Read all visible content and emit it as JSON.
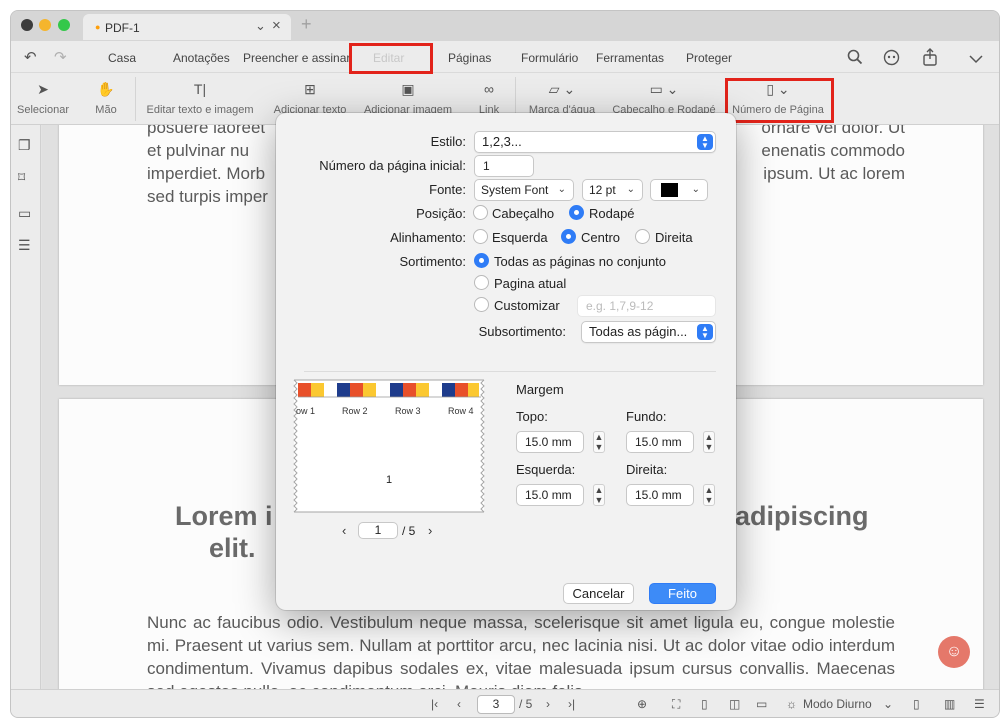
{
  "window": {
    "tab_title": "PDF-1",
    "tab_dot": "●",
    "tab_chevron": "⌄",
    "tab_close": "×",
    "new_tab": "+"
  },
  "menu": {
    "undo": "↶",
    "redo": "↷",
    "items": [
      "Casa",
      "Anotações",
      "Preencher e assinar",
      "Editar",
      "Páginas",
      "Formulário",
      "Ferramentas",
      "Proteger"
    ],
    "active": "Editar"
  },
  "toolbar": {
    "tools": [
      {
        "label": "Selecionar",
        "icon": "cursor-icon"
      },
      {
        "label": "Mão",
        "icon": "hand-icon"
      },
      {
        "label": "Editar texto e imagem",
        "icon": "text-edit-icon"
      },
      {
        "label": "Adicionar texto",
        "icon": "add-text-icon"
      },
      {
        "label": "Adicionar imagem",
        "icon": "add-image-icon"
      },
      {
        "label": "Link",
        "icon": "link-icon"
      },
      {
        "label": "Marca d'água",
        "icon": "watermark-icon"
      },
      {
        "label": "Cabeçalho e Rodapé",
        "icon": "header-footer-icon"
      },
      {
        "label": "Número de Página",
        "icon": "page-number-icon"
      }
    ]
  },
  "document": {
    "para1_lines": [
      "posuere laoreet",
      "et pulvinar nu",
      "imperdiet. Morb",
      "sed turpis imper"
    ],
    "para1_right": [
      "ornare vel dolor. Ut",
      "enenatis commodo",
      "ipsum. Ut ac lorem",
      ""
    ],
    "heading_left": "Lorem i",
    "heading_left2": "elit.",
    "heading_right": "adipiscing",
    "para2": "Nunc ac faucibus odio. Vestibulum neque massa, scelerisque sit amet ligula eu, congue molestie mi. Praesent ut varius sem. Nullam at porttitor arcu, nec lacinia nisi. Ut ac dolor vitae odio interdum condimentum. Vivamus dapibus sodales ex, vitae malesuada ipsum cursus convallis. Maecenas sed egestas nulla, ac condimentum orci. Mauris diam felis,"
  },
  "status": {
    "current_page": "3",
    "total": "/ 5",
    "mode": "Modo Diurno"
  },
  "dialog": {
    "estilo_label": "Estilo:",
    "estilo_value": "1,2,3...",
    "start_label": "Número da página inicial:",
    "start_value": "1",
    "fonte_label": "Fonte:",
    "font_value": "System Font",
    "size_value": "12 pt",
    "color_value": "#000000",
    "posicao_label": "Posição:",
    "pos_options": [
      "Cabeçalho",
      "Rodapé"
    ],
    "pos_selected": "Rodapé",
    "alinhamento_label": "Alinhamento:",
    "align_options": [
      "Esquerda",
      "Centro",
      "Direita"
    ],
    "align_selected": "Centro",
    "sortimento_label": "Sortimento:",
    "sort_options": [
      "Todas as páginas no conjunto",
      "Pagina atual",
      "Customizar"
    ],
    "sort_selected": "Todas as páginas no conjunto",
    "custom_placeholder": "e.g. 1,7,9-12",
    "subsort_label": "Subsortimento:",
    "subsort_value": "Todas as págin...",
    "preview": {
      "columns": [
        "ow 1",
        "Row 2",
        "Row 3",
        "Row 4"
      ],
      "page_number": "1",
      "nav_page": "1",
      "nav_total": "/ 5",
      "colors": [
        "#e8502a",
        "#fbc831",
        "#1e3c8c",
        "#ffffff"
      ]
    },
    "margem_title": "Margem",
    "margins": [
      {
        "label": "Topo:",
        "value": "15.0 mm"
      },
      {
        "label": "Fundo:",
        "value": "15.0 mm"
      },
      {
        "label": "Esquerda:",
        "value": "15.0 mm"
      },
      {
        "label": "Direita:",
        "value": "15.0 mm"
      }
    ],
    "cancel_label": "Cancelar",
    "done_label": "Feito"
  },
  "colors": {
    "accent": "#2f7cf6",
    "highlight": "#e2231a"
  }
}
